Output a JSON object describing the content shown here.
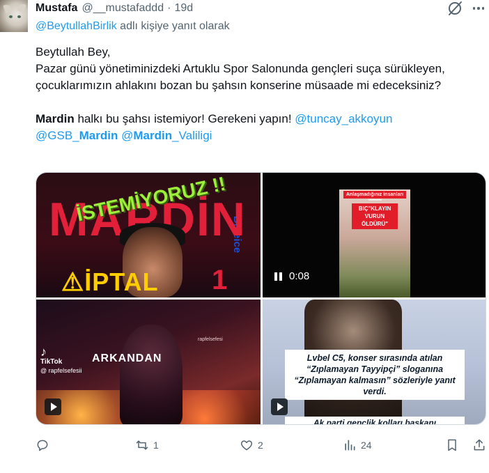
{
  "tweet": {
    "author_name": "Mustafa",
    "author_handle": "@__mustafaddd",
    "separator": "·",
    "time": "19d",
    "reply_to": {
      "mention": "@BeytullahBirlik",
      "suffix": " adlı kişiye yanıt olarak"
    },
    "body": {
      "line1": "Beytullah Bey,",
      "line2": "Pazar günü yönetiminizdeki Artuklu Spor Salonunda gençleri suça sürükleyen, çocuklarımızın ahlakını bozan bu şahsın konserine müsaade mi edeceksiniz?",
      "line3_bold": "Mardin",
      "line3_text": " halkı bu şahsı istemiyor! Gerekeni yapın! ",
      "line3_mention": "@tuncay_akkoyun",
      "mention_gsb_prefix": "@GSB_",
      "mention_gsb_bold": "Mardin",
      "mention_vali_prefix": "@",
      "mention_vali_bold": "Mardin",
      "mention_vali_suffix": "_Valiligi"
    }
  },
  "media": {
    "tile1": {
      "banner": "İSTEMİYORUZ !!",
      "title": "MARDİN",
      "side_text": "Blueice",
      "bottom": "⚠İPTAL",
      "badge": "1"
    },
    "tile2": {
      "caption_top": "Anlaşmadığınız insanları",
      "stars": "**************",
      "caption_main": "BIÇ\"KLAYIN VURUN ÖLDÜRÜ\"",
      "duration": "0:08"
    },
    "tile3": {
      "title": "ARKANDAN",
      "watermark": "rapfelsefesi",
      "tiktok_label": "TikTok",
      "tiktok_user": "@ rapfelsefesii"
    },
    "tile4": {
      "headline": "Lvbel C5, konser sırasında atılan “Zıplamayan Tayyipçi” sloganına “Zıplamayan kalmasın” sözleriyle yanıt verdi.",
      "sub": "Ak parti gençlik kolları başkanı"
    }
  },
  "actions": {
    "reply_count": "",
    "retweet_count": "1",
    "like_count": "2",
    "view_count": "24"
  },
  "colors": {
    "link": "#1d9bf0",
    "secondary_text": "#536471",
    "primary_text": "#0f1419",
    "border": "#cfd9de"
  },
  "icons": [
    "grok-icon",
    "more-icon",
    "reply-icon",
    "retweet-icon",
    "like-icon",
    "views-icon",
    "bookmark-icon",
    "share-icon",
    "play-icon",
    "pause-icon"
  ]
}
